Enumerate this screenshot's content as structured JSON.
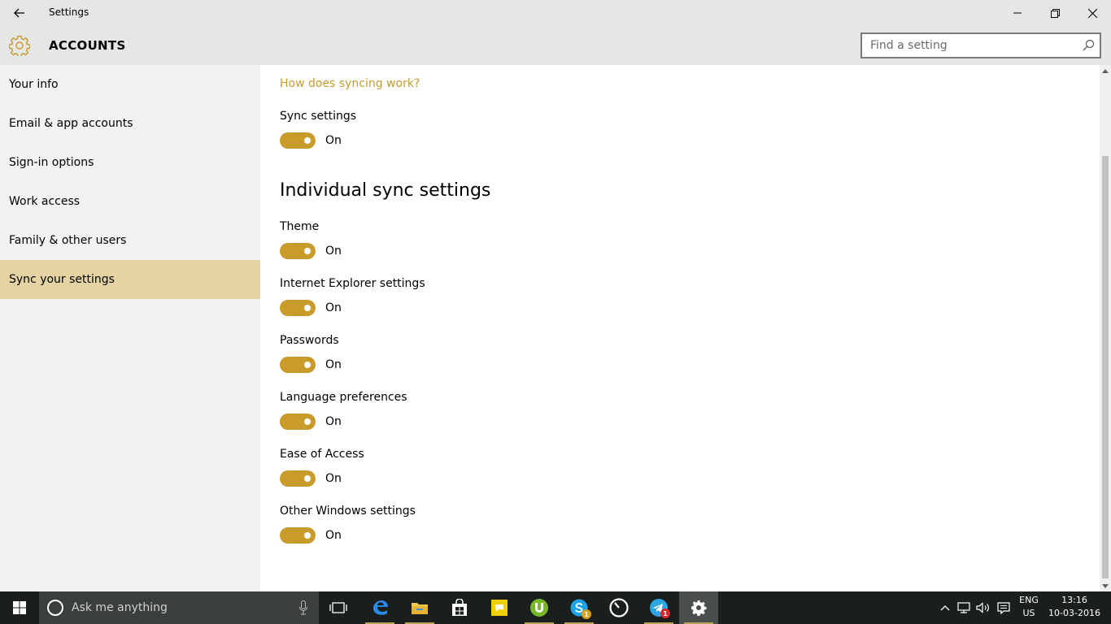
{
  "window": {
    "title": "Settings"
  },
  "header": {
    "section_title": "ACCOUNTS",
    "search_placeholder": "Find a setting"
  },
  "sidebar": {
    "items": [
      {
        "label": "Your info"
      },
      {
        "label": "Email & app accounts"
      },
      {
        "label": "Sign-in options"
      },
      {
        "label": "Work access"
      },
      {
        "label": "Family & other users"
      },
      {
        "label": "Sync your settings",
        "active": true
      }
    ]
  },
  "main": {
    "help_link": "How does syncing work?",
    "sync_settings": {
      "label": "Sync settings",
      "state": "On"
    },
    "individual_heading": "Individual sync settings",
    "toggles": [
      {
        "label": "Theme",
        "state": "On"
      },
      {
        "label": "Internet Explorer settings",
        "state": "On"
      },
      {
        "label": "Passwords",
        "state": "On"
      },
      {
        "label": "Language preferences",
        "state": "On"
      },
      {
        "label": "Ease of Access",
        "state": "On"
      },
      {
        "label": "Other Windows settings",
        "state": "On"
      }
    ]
  },
  "taskbar": {
    "search_text": "Ask me anything",
    "apps": [
      "task-view",
      "edge",
      "file-explorer",
      "store",
      "sticky-notes",
      "utorrent",
      "skype",
      "clock-app",
      "telegram",
      "settings"
    ],
    "skype_badge": "1",
    "telegram_badge": "1",
    "language_line1": "ENG",
    "language_line2": "US",
    "time": "13:16",
    "date": "10-03-2016"
  },
  "colors": {
    "accent": "#c89b2b",
    "accent_link": "#c59c2b",
    "selected_nav": "#e6d3a3",
    "chrome": "#e6e6e6",
    "sidebar_bg": "#f2f2f2",
    "taskbar_bg": "#1a1f1d"
  }
}
